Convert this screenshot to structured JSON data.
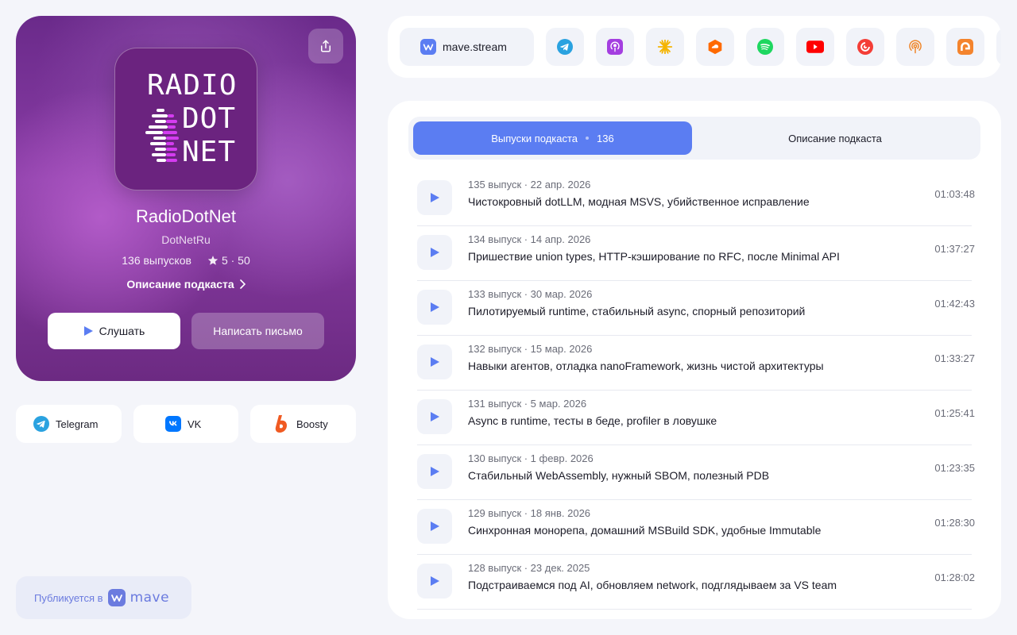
{
  "podcast": {
    "title": "RadioDotNet",
    "author": "DotNetRu",
    "episodes_count": "136 выпусков",
    "rating": "5 · 50",
    "description_link": "Описание подкаста",
    "listen_label": "Слушать",
    "write_label": "Написать письмо",
    "cover": {
      "line1": "RADIO",
      "line2": "DOT",
      "line3": "NET"
    }
  },
  "socials": [
    {
      "label": "Telegram",
      "icon": "telegram-icon"
    },
    {
      "label": "VK",
      "icon": "vk-icon"
    },
    {
      "label": "Boosty",
      "icon": "boosty-icon"
    }
  ],
  "publish": {
    "label": "Публикуется в",
    "brand": "mave"
  },
  "platforms": {
    "mave_label": "mave.stream",
    "items": [
      "telegram-icon",
      "apple-podcasts-icon",
      "yandex-music-icon",
      "soundstream-icon",
      "spotify-icon",
      "youtube-icon",
      "pocket-casts-icon",
      "castbox-icon",
      "podcast-addict-icon",
      "rss-icon"
    ]
  },
  "tabs": {
    "episodes_label": "Выпуски подкаста",
    "episodes_count": "136",
    "description_label": "Описание подкаста"
  },
  "episodes": [
    {
      "meta": "135 выпуск · 22 апр. 2026",
      "title": "Чистокровный dotLLM, модная MSVS, убийственное исправление",
      "duration": "01:03:48"
    },
    {
      "meta": "134 выпуск · 14 апр. 2026",
      "title": "Пришествие union types, HTTP-кэширование по RFC, после Minimal API",
      "duration": "01:37:27"
    },
    {
      "meta": "133 выпуск · 30 мар. 2026",
      "title": "Пилотируемый runtime, стабильный async, спорный репозиторий",
      "duration": "01:42:43"
    },
    {
      "meta": "132 выпуск · 15 мар. 2026",
      "title": "Навыки агентов, отладка nanoFramework, жизнь чистой архитектуры",
      "duration": "01:33:27"
    },
    {
      "meta": "131 выпуск · 5 мар. 2026",
      "title": "Async в runtime, тесты в беде, profiler в ловушке",
      "duration": "01:25:41"
    },
    {
      "meta": "130 выпуск · 1 февр. 2026",
      "title": "Стабильный WebAssembly, нужный SBOM, полезный PDB",
      "duration": "01:23:35"
    },
    {
      "meta": "129 выпуск · 18 янв. 2026",
      "title": "Синхронная монорепа, домашний MSBuild SDK, удобные Immutable",
      "duration": "01:28:30"
    },
    {
      "meta": "128 выпуск · 23 дек. 2025",
      "title": "Подстраиваемся под AI, обновляем network, подглядываем за VS team",
      "duration": "01:28:02"
    }
  ],
  "colors": {
    "accent": "#5b7df2",
    "hero": "#7a3298",
    "cover_accent": "#d43cf0"
  }
}
